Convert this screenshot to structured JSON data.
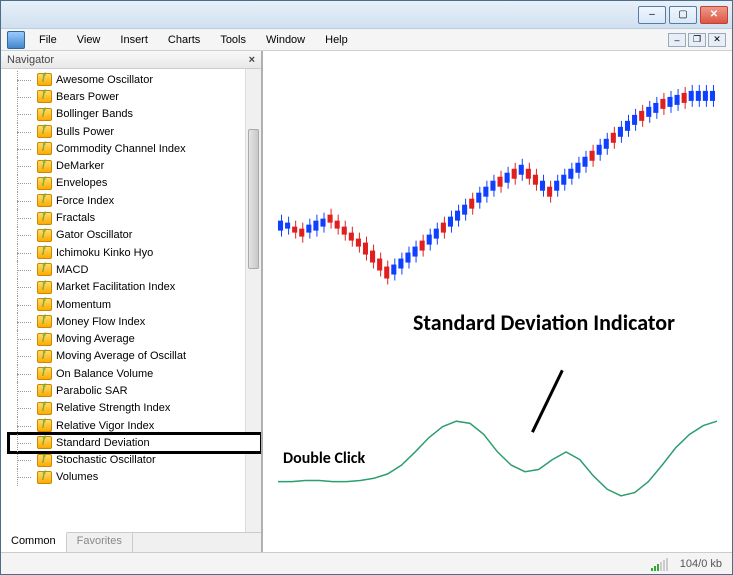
{
  "window": {
    "minimize": "–",
    "maximize": "▢",
    "close": "✕"
  },
  "mdi": {
    "minimize": "–",
    "restore": "❐",
    "close": "✕"
  },
  "menubar": [
    "File",
    "View",
    "Insert",
    "Charts",
    "Tools",
    "Window",
    "Help"
  ],
  "navigator": {
    "title": "Navigator",
    "close": "×",
    "tabs": {
      "common": "Common",
      "favorites": "Favorites"
    },
    "items": [
      "Awesome Oscillator",
      "Bears Power",
      "Bollinger Bands",
      "Bulls Power",
      "Commodity Channel Index",
      "DeMarker",
      "Envelopes",
      "Force Index",
      "Fractals",
      "Gator Oscillator",
      "Ichimoku Kinko Hyo",
      "MACD",
      "Market Facilitation Index",
      "Momentum",
      "Money Flow Index",
      "Moving Average",
      "Moving Average of Oscillat",
      "On Balance Volume",
      "Parabolic SAR",
      "Relative Strength Index",
      "Relative Vigor Index",
      "Standard Deviation",
      "Stochastic Oscillator",
      "Volumes"
    ],
    "highlight_index": 21
  },
  "annotations": {
    "title": "Standard Deviation Indicator",
    "double_click": "Double Click"
  },
  "statusbar": {
    "traffic": "104/0 kb"
  },
  "chart_data": {
    "type": "candlestick+line",
    "note": "approximate pixel-space values read from screenshot (no numeric axes shown)",
    "candles_approx_count": 62,
    "indicator_line_relative": [
      0.35,
      0.35,
      0.36,
      0.36,
      0.35,
      0.35,
      0.36,
      0.38,
      0.42,
      0.5,
      0.62,
      0.75,
      0.85,
      0.9,
      0.88,
      0.78,
      0.62,
      0.5,
      0.44,
      0.46,
      0.55,
      0.62,
      0.55,
      0.4,
      0.28,
      0.22,
      0.25,
      0.35,
      0.5,
      0.66,
      0.78,
      0.86,
      0.9
    ],
    "indicator_color": "#2e9e6f"
  }
}
